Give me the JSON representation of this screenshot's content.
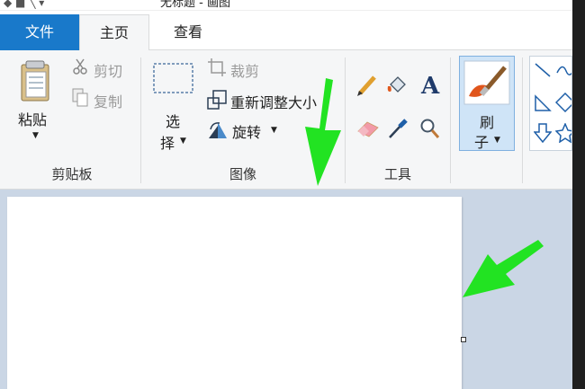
{
  "title_bar": {
    "title": "无标题 - 画图"
  },
  "tabs": [
    {
      "label": "文件"
    },
    {
      "label": "主页"
    },
    {
      "label": "查看"
    }
  ],
  "clipboard": {
    "paste_label": "粘贴",
    "cut_label": "剪切",
    "copy_label": "复制",
    "group_label": "剪贴板"
  },
  "image": {
    "select_label_1": "选",
    "select_label_2": "择",
    "crop_label": "裁剪",
    "resize_label": "重新调整大小",
    "rotate_label": "旋转",
    "group_label": "图像"
  },
  "tools": {
    "group_label": "工具",
    "brush_label_1": "刷",
    "brush_label_2": "子"
  },
  "colors": {
    "file_tab": "#1979ca",
    "ribbon_bg": "#f5f6f7",
    "workspace_bg": "#cad6e5",
    "annotation_arrow": "#22e322",
    "selected_tool": "#cfe4f7"
  }
}
